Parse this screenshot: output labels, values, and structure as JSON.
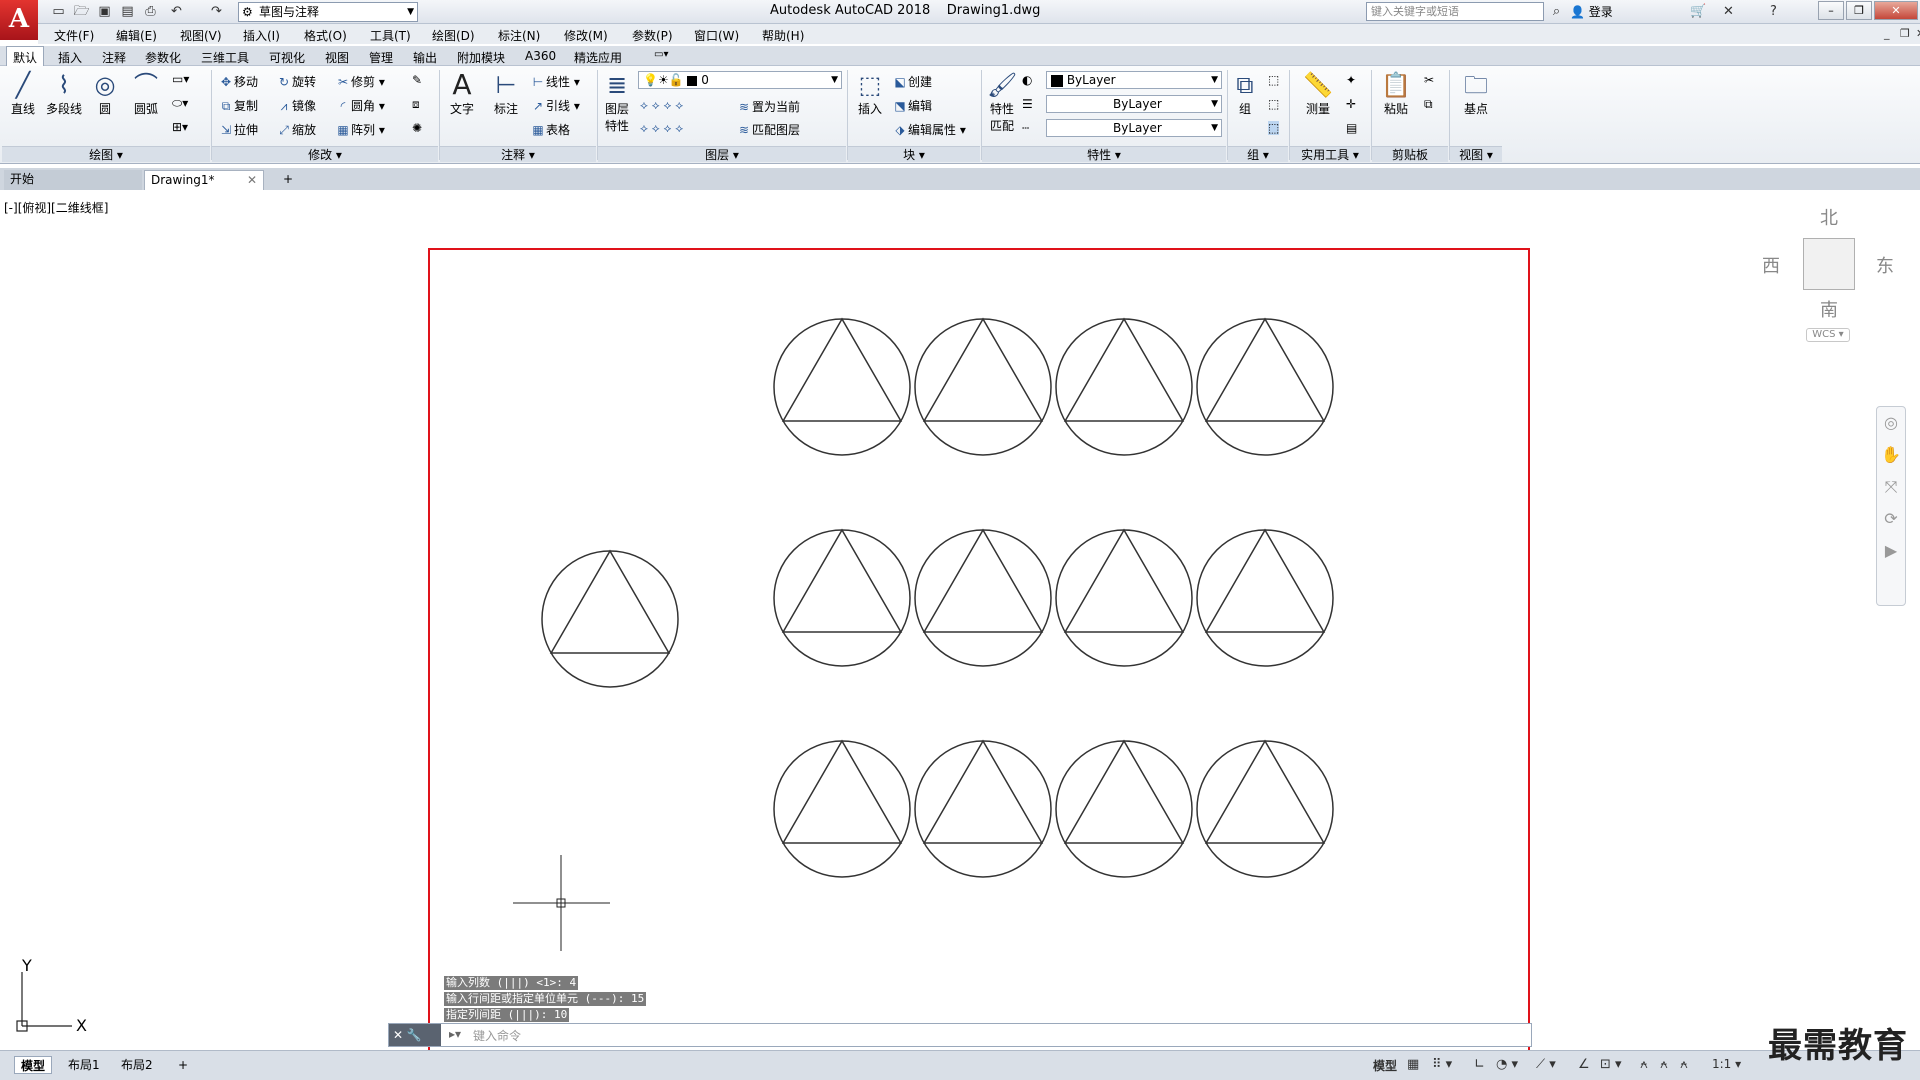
{
  "app": {
    "title": "Autodesk AutoCAD 2018",
    "document": "Drawing1.dwg",
    "logo": "A",
    "workspace": "草图与注释",
    "search_placeholder": "键入关键字或短语",
    "login_label": "登录"
  },
  "menu": [
    "文件(F)",
    "编辑(E)",
    "视图(V)",
    "插入(I)",
    "格式(O)",
    "工具(T)",
    "绘图(D)",
    "标注(N)",
    "修改(M)",
    "参数(P)",
    "窗口(W)",
    "帮助(H)"
  ],
  "ribbon_tabs": [
    "默认",
    "插入",
    "注释",
    "参数化",
    "三维工具",
    "可视化",
    "视图",
    "管理",
    "输出",
    "附加模块",
    "A360",
    "精选应用"
  ],
  "ribbon": {
    "draw": {
      "title": "绘图",
      "tools": [
        "直线",
        "多段线",
        "圆",
        "圆弧"
      ]
    },
    "modify": {
      "title": "修改",
      "tools": [
        "移动",
        "旋转",
        "修剪",
        "复制",
        "镜像",
        "圆角",
        "拉伸",
        "缩放",
        "阵列"
      ]
    },
    "annotation": {
      "title": "注释",
      "big": [
        "文字",
        "标注"
      ],
      "small": [
        "线性",
        "引线",
        "表格"
      ]
    },
    "layers": {
      "title": "图层",
      "big": "图层\n特性",
      "layer_value": "0",
      "small": [
        "置为当前",
        "匹配图层"
      ]
    },
    "block": {
      "title": "块",
      "big": "插入",
      "small": [
        "创建",
        "编辑",
        "编辑属性"
      ]
    },
    "properties": {
      "title": "特性",
      "big": "特性\n匹配",
      "color": "ByLayer",
      "linetype": "ByLayer",
      "lineweight": "ByLayer"
    },
    "group": {
      "title": "组",
      "big": "组"
    },
    "utilities": {
      "title": "实用工具",
      "big": "测量"
    },
    "clipboard": {
      "title": "剪贴板",
      "big": "粘贴"
    },
    "view": {
      "title": "视图",
      "big": "基点"
    }
  },
  "file_tabs": {
    "start": "开始",
    "doc": "Drawing1*",
    "add": "+"
  },
  "viewport": {
    "label": "[-][俯视][二维线框]",
    "compass": {
      "north": "北",
      "south": "南",
      "east": "东",
      "west": "西"
    },
    "wcs": "WCS",
    "ucs_x": "X",
    "ucs_y": "Y"
  },
  "drawing": {
    "description": "circles with inscribed equilateral triangles; one source plus rectangular array 3 rows x 4 columns",
    "array_rows": 3,
    "array_columns": 4
  },
  "command_history": [
    "输入列数 (|||) <1>: 4",
    "输入行间距或指定单位单元 (---): 15",
    "指定列间距 (|||): 10"
  ],
  "command_placeholder": "键入命令",
  "status": {
    "tabs": [
      "模型",
      "布局1",
      "布局2"
    ],
    "add": "+",
    "model_label": "模型",
    "scale": "1:1"
  },
  "watermark": "最需教育",
  "colors": {
    "highlight": "#e0121a",
    "accent": "#c8151c"
  }
}
